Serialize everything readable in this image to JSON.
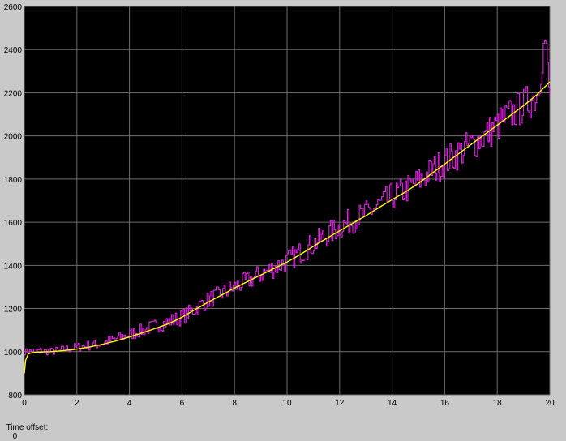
{
  "window": {
    "time_offset_label": "Time offset:",
    "time_offset_value": "0"
  },
  "colors": {
    "background": "#c9c9c9",
    "plot_background": "#000000",
    "grid": "#6e6e6e",
    "tick_text": "#000000"
  },
  "chart_data": {
    "type": "line",
    "title": "",
    "xlabel": "",
    "ylabel": "",
    "xlim": [
      0,
      20
    ],
    "ylim": [
      800,
      2600
    ],
    "grid": true,
    "x_ticks": [
      "0",
      "2",
      "4",
      "6",
      "8",
      "10",
      "12",
      "14",
      "16",
      "18",
      "20"
    ],
    "y_ticks": [
      "800",
      "1000",
      "1200",
      "1400",
      "1600",
      "1800",
      "2000",
      "2200",
      "2400",
      "2600"
    ],
    "series": [
      {
        "color": "#e020e0",
        "style": "noisy",
        "x": [
          0,
          0.5,
          1,
          1.5,
          2,
          2.5,
          3,
          3.5,
          4,
          4.5,
          5,
          5.5,
          6,
          6.5,
          7,
          7.5,
          8,
          8.5,
          9,
          9.5,
          10,
          10.5,
          11,
          11.5,
          12,
          12.5,
          13,
          13.5,
          14,
          14.5,
          15,
          15.5,
          16,
          16.5,
          17,
          17.5,
          18,
          18.5,
          19,
          19.5,
          19.8,
          20
        ],
        "y": [
          1000,
          1005,
          1000,
          1010,
          1020,
          1030,
          1040,
          1060,
          1080,
          1100,
          1120,
          1140,
          1160,
          1200,
          1240,
          1270,
          1300,
          1330,
          1360,
          1390,
          1420,
          1460,
          1500,
          1540,
          1580,
          1610,
          1640,
          1680,
          1720,
          1750,
          1790,
          1840,
          1880,
          1920,
          1960,
          2000,
          2050,
          2100,
          2140,
          2190,
          2450,
          2150
        ]
      },
      {
        "color": "#ffff00",
        "style": "smooth",
        "x": [
          0,
          0.05,
          0.15,
          0.3,
          0.5,
          1,
          1.5,
          2,
          2.5,
          3,
          3.5,
          4,
          4.5,
          5,
          5.5,
          6,
          6.5,
          7,
          7.5,
          8,
          8.5,
          9,
          9.5,
          10,
          10.5,
          11,
          11.5,
          12,
          12.5,
          13,
          13.5,
          14,
          14.5,
          15,
          15.5,
          16,
          16.5,
          17,
          17.5,
          18,
          18.5,
          19,
          19.5,
          20
        ],
        "y": [
          900,
          960,
          990,
          995,
          998,
          1000,
          1005,
          1012,
          1022,
          1035,
          1050,
          1068,
          1088,
          1108,
          1130,
          1160,
          1195,
          1230,
          1262,
          1295,
          1325,
          1355,
          1385,
          1415,
          1450,
          1488,
          1525,
          1560,
          1595,
          1630,
          1668,
          1705,
          1740,
          1780,
          1825,
          1870,
          1915,
          1960,
          2005,
          2050,
          2095,
          2140,
          2190,
          2250
        ]
      }
    ]
  }
}
